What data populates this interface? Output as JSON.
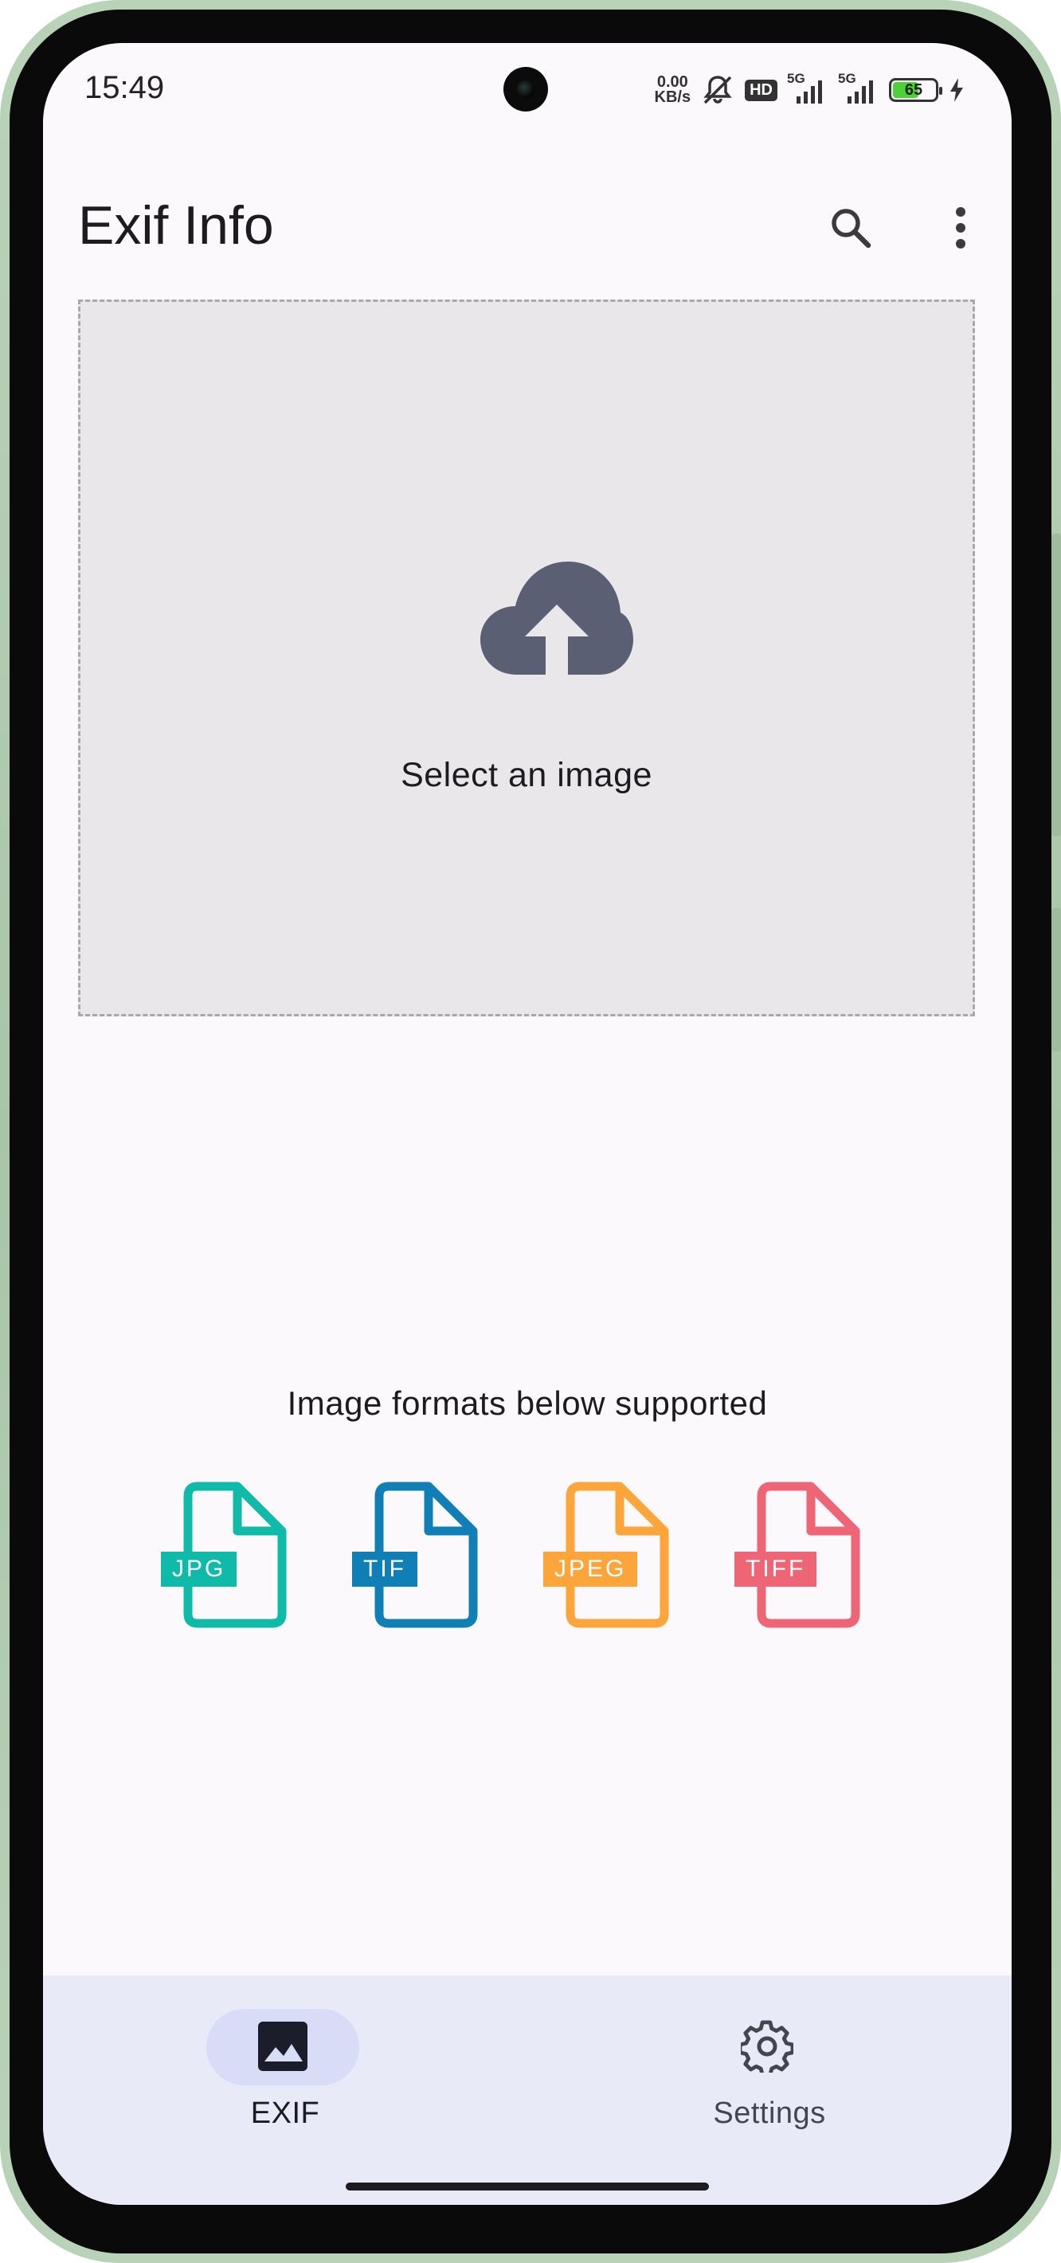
{
  "status_bar": {
    "time": "15:49",
    "net_speed_value": "0.00",
    "net_speed_unit": "KB/s",
    "hd_label": "HD",
    "signal_1_label": "5G",
    "signal_2_label": "5G",
    "battery_level": "65",
    "icons": [
      "mute-icon",
      "hd-voice-icon",
      "signal-5g-icon",
      "signal-5g-icon",
      "battery-icon",
      "charging-icon"
    ]
  },
  "app_bar": {
    "title": "Exif Info",
    "actions": [
      "search-icon",
      "more-vert-icon"
    ]
  },
  "drop_zone": {
    "label": "Select an image",
    "icon": "cloud-upload-icon"
  },
  "formats": {
    "caption": "Image formats below supported",
    "items": [
      {
        "label": "JPG",
        "color": "#0fbaa9"
      },
      {
        "label": "TIF",
        "color": "#0f7fb5"
      },
      {
        "label": "JPEG",
        "color": "#fca53a"
      },
      {
        "label": "TIFF",
        "color": "#ee6575"
      }
    ]
  },
  "bottom_nav": {
    "items": [
      {
        "label": "EXIF",
        "icon": "image-icon",
        "selected": true
      },
      {
        "label": "Settings",
        "icon": "gear-icon",
        "selected": false
      }
    ]
  },
  "colors": {
    "background": "#fcf9fc",
    "drop_zone_bg": "#e9e7ea",
    "upload_icon": "#5b5f74",
    "nav_bg": "#e8eaf8",
    "nav_pill": "#d8dcf6",
    "frame": "#b9d3b8"
  }
}
